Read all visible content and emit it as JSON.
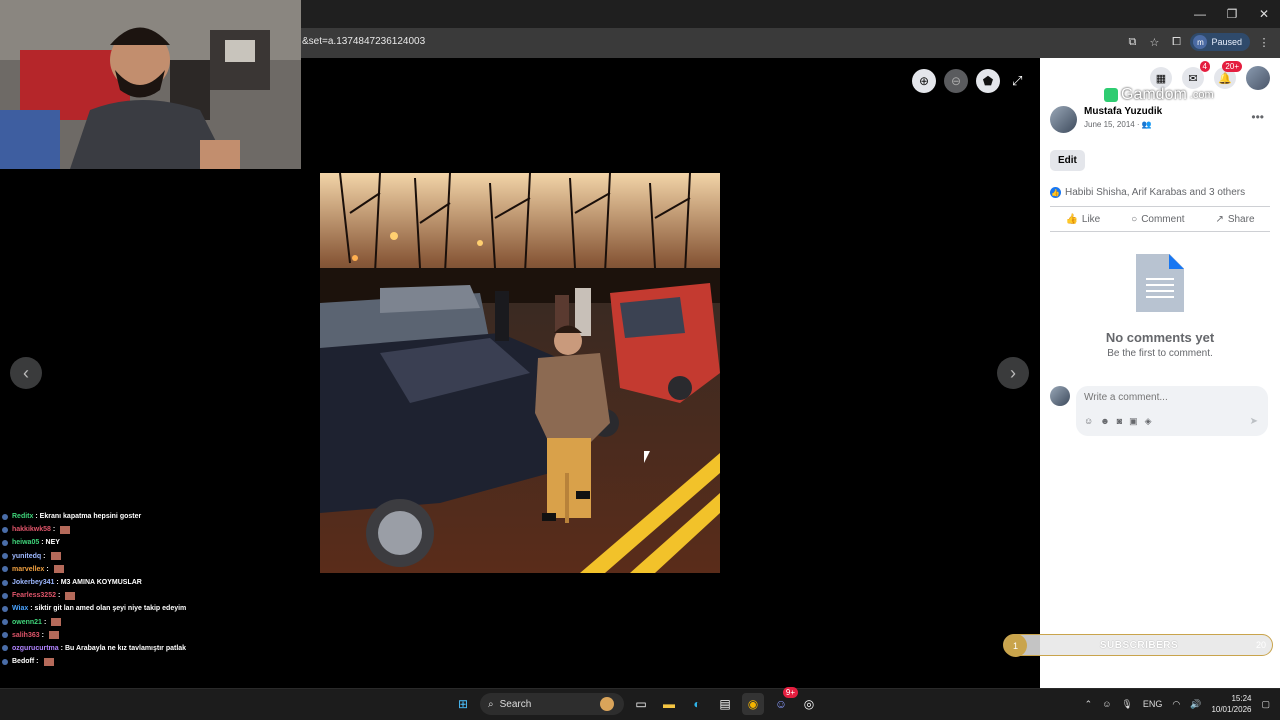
{
  "browser": {
    "url": "&set=a.1374847236124003",
    "paused_label": "Paused",
    "profile_initial": "m",
    "window_controls": [
      "—",
      "❐",
      "✕"
    ]
  },
  "viewer": {
    "tools": [
      "zoom-in-icon",
      "zoom-out-icon",
      "tag-icon"
    ],
    "prev_arrow": "‹",
    "next_arrow": "›"
  },
  "facebook": {
    "badges": {
      "messenger": "4",
      "notifications": "20+"
    },
    "post": {
      "author": "Mustafa Yuzudik",
      "date": "June 15, 2014 · ",
      "edit_label": "Edit",
      "reactions_text": "Habibi Shisha, Arif Karabas and 3 others",
      "actions": {
        "like": "Like",
        "comment": "Comment",
        "share": "Share"
      }
    },
    "comments": {
      "empty_title": "No comments yet",
      "empty_sub": "Be the first to comment.",
      "placeholder": "Write a comment..."
    }
  },
  "overlay": {
    "gamdom": "Gamdom",
    "gamdom_suffix": ".com",
    "chat": [
      {
        "user": "Reditx",
        "color": "#3fd47a",
        "msg": ": Ekranı kapatma hepsini goster"
      },
      {
        "user": "hakkikwk58",
        "color": "#e0556a",
        "msg": " :",
        "emote": true
      },
      {
        "user": "heiwa05",
        "color": "#3fd47a",
        "msg": ": NEY"
      },
      {
        "user": "yunitedq",
        "color": "#9db8ff",
        "msg": " :",
        "emote": true
      },
      {
        "user": "marvellex",
        "color": "#f0a040",
        "msg": " :",
        "emote": true
      },
      {
        "user": "Jokerbey341",
        "color": "#9db8ff",
        "msg": ": M3 AMINA KOYMUSLAR"
      },
      {
        "user": "Fearless3252",
        "color": "#e0556a",
        "msg": " :",
        "emote": true
      },
      {
        "user": "Wiax",
        "color": "#4aa3ff",
        "msg": ": siktir git lan amed olan şeyi niye takip edeyim"
      },
      {
        "user": "owenn21",
        "color": "#3fd47a",
        "msg": " :",
        "emote": true
      },
      {
        "user": "salih363",
        "color": "#e0556a",
        "msg": " :",
        "emote": true
      },
      {
        "user": "ozgurucurtma",
        "color": "#b184ff",
        "msg": ": Bu Arabayla ne kız tavlamıştır patlak"
      },
      {
        "user": "Bedoff",
        "color": "#ffffff",
        "msg": " :",
        "emote": true
      }
    ],
    "subs": {
      "count": "1",
      "label": "SUBSCRIBERS",
      "goal": "20"
    }
  },
  "taskbar": {
    "search_label": "Search",
    "lang": "ENG",
    "time": "15:24",
    "date": "10/01/2026",
    "discord_badge": "9+"
  }
}
